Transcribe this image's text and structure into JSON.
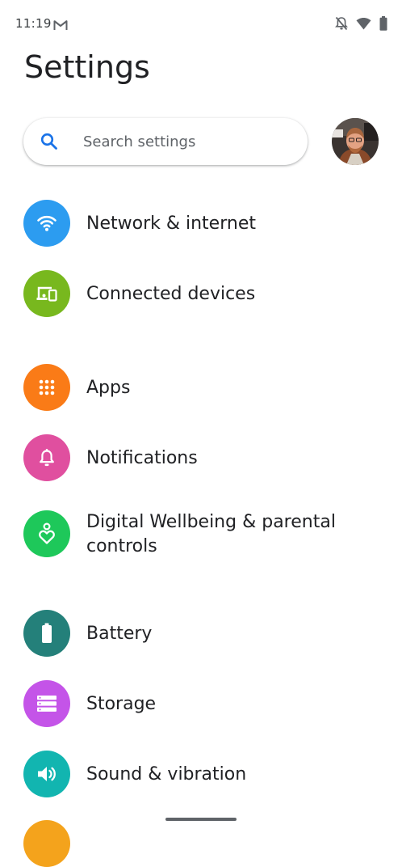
{
  "status_bar": {
    "time": "11:19",
    "icons": [
      "gmail-icon",
      "notifications-off-icon",
      "wifi-icon",
      "battery-icon"
    ]
  },
  "header": {
    "title": "Settings"
  },
  "search": {
    "placeholder": "Search settings"
  },
  "settings": {
    "items": [
      {
        "label": "Network & internet",
        "icon": "wifi-icon",
        "color": "#2c9cf0"
      },
      {
        "label": "Connected devices",
        "icon": "devices-icon",
        "color": "#78b81e"
      },
      {
        "label": "Apps",
        "icon": "apps-grid-icon",
        "color": "#fa7b17"
      },
      {
        "label": "Notifications",
        "icon": "bell-icon",
        "color": "#e04f9f"
      },
      {
        "label": "Digital Wellbeing & parental controls",
        "label_line1": "Digital Wellbeing & parental",
        "label_line2": "controls",
        "icon": "wellbeing-icon",
        "color": "#1ec85a"
      },
      {
        "label": "Battery",
        "icon": "battery-icon",
        "color": "#24807a"
      },
      {
        "label": "Storage",
        "icon": "storage-icon",
        "color": "#c454e8"
      },
      {
        "label": "Sound & vibration",
        "icon": "volume-icon",
        "color": "#12b5b0"
      }
    ]
  }
}
